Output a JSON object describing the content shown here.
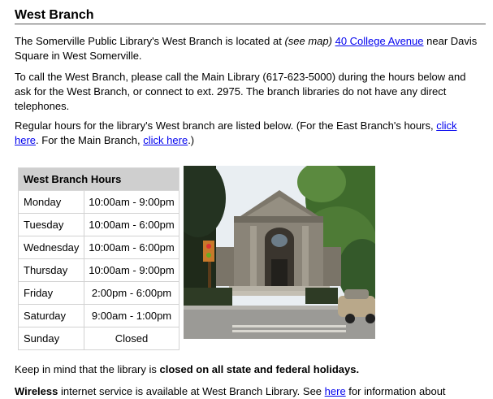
{
  "section_title": "West Branch",
  "intro": {
    "text_before_map": "The Somerville Public Library's West Branch is located at ",
    "see_map": "(see map)",
    "address_link": "40 College Avenue",
    "text_after_address": " near Davis Square in West Somerville."
  },
  "phone_paragraph": "To call the West Branch, please call the Main Library (617-623-5000) during the hours below and ask for the West Branch, or connect to ext. 2975. The branch libraries do not have any direct telephones.",
  "hours_paragraph": {
    "text_before_link": "Regular hours for the library's West branch are listed below. (For the East Branch's hours, ",
    "east_link": "click here",
    "text_middle": ". For the Main Branch, ",
    "main_link": "click here",
    "text_end": ".)"
  },
  "hours_table": {
    "header": "West Branch Hours",
    "rows": [
      {
        "day": "Monday",
        "hours": "10:00am - 9:00pm"
      },
      {
        "day": "Tuesday",
        "hours": "10:00am - 6:00pm"
      },
      {
        "day": "Wednesday",
        "hours": "10:00am - 6:00pm"
      },
      {
        "day": "Thursday",
        "hours": "10:00am - 9:00pm"
      },
      {
        "day": "Friday",
        "hours": "2:00pm - 6:00pm"
      },
      {
        "day": "Saturday",
        "hours": "9:00am - 1:00pm"
      },
      {
        "day": "Sunday",
        "hours": "Closed"
      }
    ]
  },
  "holiday_paragraph": {
    "text_before": "Keep in mind that the library is ",
    "bold": "closed on all state and federal holidays.",
    "text_after": ""
  },
  "wireless_paragraph": {
    "bold": "Wireless",
    "text_before_link": " internet service is available at West Branch Library. See ",
    "link": "here",
    "text_after_link": " for information about"
  },
  "colors": {
    "link": "#0000ee",
    "table_header_bg": "#cfcfcf",
    "sky": "#eef3f7",
    "foliage": "#3f6b2c",
    "building": "#8a8478"
  }
}
